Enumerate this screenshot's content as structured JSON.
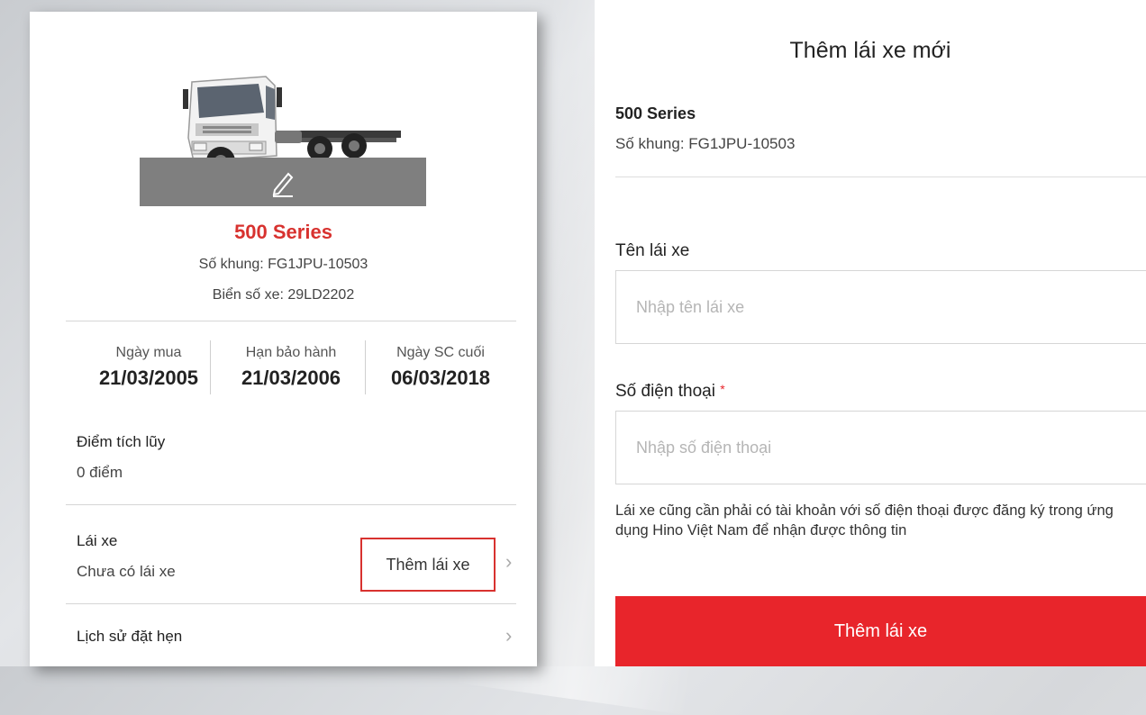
{
  "vehicle_card": {
    "model_name": "500 Series",
    "chassis": "Số khung:  FG1JPU-10503",
    "plate": "Biển số xe: 29LD2202",
    "stats": [
      {
        "label": "Ngày mua",
        "value": "21/03/2005"
      },
      {
        "label": "Hạn bảo hành",
        "value": "21/03/2006"
      },
      {
        "label": "Ngày SC cuối",
        "value": "06/03/2018"
      }
    ],
    "points_label": "Điểm tích lũy",
    "points_value": "0 điểm",
    "driver_label": "Lái xe",
    "driver_value": "Chưa có lái xe",
    "add_driver_label": "Thêm lái xe",
    "booking_history_label": "Lịch sử đặt hẹn",
    "icons": {
      "edit": "pencil-icon",
      "chevron": "chevron-right-icon"
    }
  },
  "add_driver_form": {
    "title": "Thêm lái xe mới",
    "model_name": "500 Series",
    "chassis": "Số khung: FG1JPU-10503",
    "name_label": "Tên lái xe",
    "name_placeholder": "Nhập tên lái xe",
    "phone_label": "Số điện thoại",
    "required_mark": "*",
    "phone_placeholder": "Nhập số điện thoại",
    "note": "Lái xe cũng cần phải có tài khoản với số điện thoại được đăng ký trong ứng dụng Hino Việt Nam để nhận được thông tin",
    "submit_label": "Thêm lái xe"
  },
  "colors": {
    "accent_red": "#e8252b",
    "title_red": "#d8322f"
  }
}
